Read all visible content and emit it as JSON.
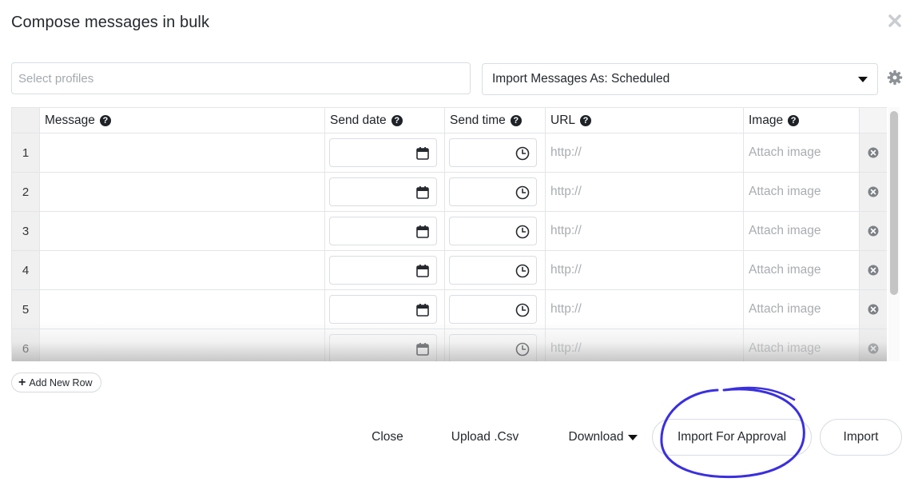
{
  "dialog": {
    "title": "Compose messages in bulk"
  },
  "profiles": {
    "placeholder": "Select profiles",
    "value": ""
  },
  "import_mode": {
    "selected": "Import Messages As: Scheduled"
  },
  "table": {
    "columns": [
      "Message",
      "Send date",
      "Send time",
      "URL",
      "Image"
    ],
    "url_placeholder": "http://",
    "image_placeholder": "Attach image",
    "rows": [
      {
        "num": "1"
      },
      {
        "num": "2"
      },
      {
        "num": "3"
      },
      {
        "num": "4"
      },
      {
        "num": "5"
      },
      {
        "num": "6"
      }
    ]
  },
  "actions": {
    "add_row": "Add New Row",
    "close": "Close",
    "upload": "Upload .Csv",
    "download": "Download",
    "import_for_approval": "Import For Approval",
    "import": "Import"
  },
  "colors": {
    "annotation": "#3a2fe0",
    "header_cell": "#f0f0f0",
    "placeholder_text": "#a9adb1"
  }
}
